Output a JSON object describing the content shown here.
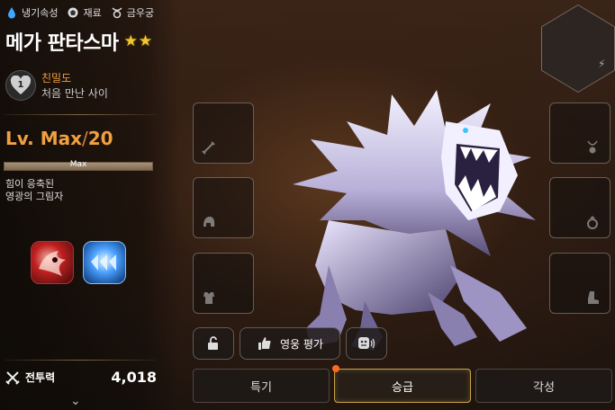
{
  "hero": {
    "tags": [
      {
        "icon": "water-drop-icon",
        "label": "냉기속성"
      },
      {
        "icon": "material-icon",
        "label": "재료"
      },
      {
        "icon": "taurus-icon",
        "label": "금우궁"
      }
    ],
    "name": "메가 판타스마",
    "stars": 2
  },
  "affinity": {
    "level": "1",
    "label": "친밀도",
    "status": "처음 만난 사이"
  },
  "level": {
    "label": "Lv. Max",
    "separator": "/",
    "cap": "20",
    "bar_label": "Max",
    "progress": 1.0
  },
  "description": {
    "line1": "힘이 응축된",
    "line2": "영광의 그림자"
  },
  "skills": [
    "skill-1-icon",
    "skill-2-icon"
  ],
  "power": {
    "label": "전투력",
    "value": "4,018"
  },
  "actions": {
    "hero_review": "영웅 평가"
  },
  "tabs": [
    {
      "label": "특기",
      "active": false
    },
    {
      "label": "승급",
      "active": true
    },
    {
      "label": "각성",
      "active": false
    }
  ],
  "colors": {
    "accent": "#f0a040",
    "star": "#f2c531",
    "notification": "#ff6a20",
    "active_tab_border": "#c9a24a"
  }
}
